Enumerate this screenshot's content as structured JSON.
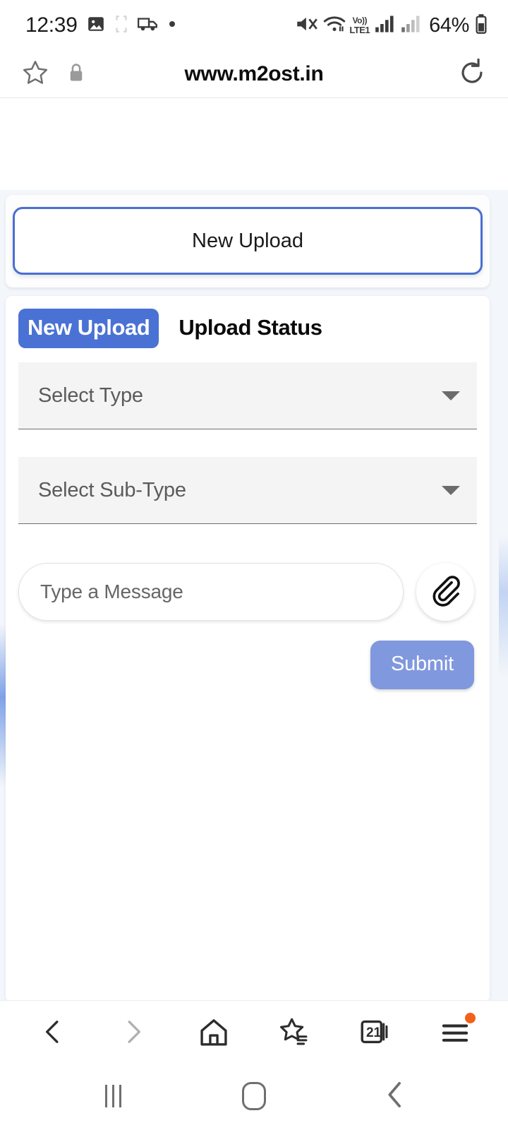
{
  "statusbar": {
    "time": "12:39",
    "battery_text": "64%",
    "volte_top": "Vo))",
    "volte_bottom": "LTE1",
    "icons": [
      "image-icon",
      "brackets-icon",
      "delivery-truck-icon",
      "dot-icon",
      "mute-icon",
      "wifi-icon",
      "volte-icon",
      "signal-icon-1",
      "signal-icon-2",
      "battery-icon"
    ]
  },
  "browser": {
    "url": "www.m2ost.in",
    "bookmark_icon": "star-icon",
    "security_icon": "lock-icon",
    "reload_icon": "reload-icon",
    "bottom_toolbar": {
      "back_label": "back-icon",
      "forward_label": "forward-icon",
      "home_label": "home-icon",
      "bookmarks_label": "bookmarks-star-icon",
      "tabs_count": "21",
      "menu_label": "menu-icon"
    }
  },
  "page": {
    "banner_title": "New Upload",
    "tabs": [
      {
        "label": "New Upload",
        "active": true
      },
      {
        "label": "Upload Status",
        "active": false
      }
    ],
    "fields": [
      {
        "name": "type",
        "placeholder": "Select Type"
      },
      {
        "name": "subtype",
        "placeholder": "Select Sub-Type"
      }
    ],
    "message": {
      "placeholder": "Type a Message",
      "value": "",
      "attach_icon": "paperclip-icon"
    },
    "submit_label": "Submit"
  },
  "android_nav": {
    "recents": "recents-icon",
    "home": "home-icon",
    "back": "back-icon"
  },
  "colors": {
    "accent_blue": "#4a72d4",
    "banner_border": "#4a6fd0",
    "submit_blue": "#8098dd",
    "page_bg": "#f3f6fa",
    "badge_orange": "#f2601a"
  }
}
